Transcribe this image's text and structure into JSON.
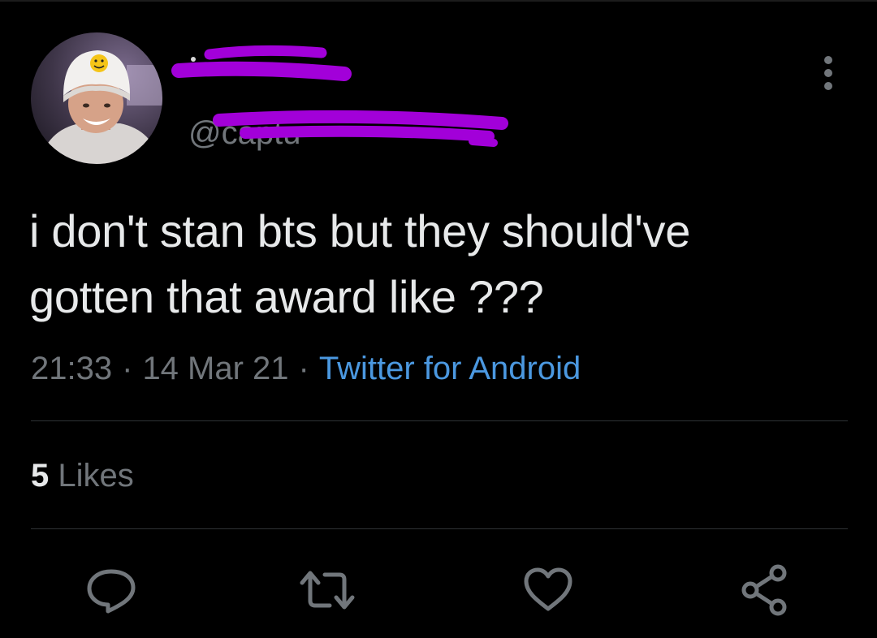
{
  "tweet": {
    "handle": "@captu",
    "text_lines": [
      "i don't stan bts but they should've",
      "gotten that award like ???"
    ],
    "time": "21:33",
    "separator": "·",
    "date": "14 Mar 21",
    "source": "Twitter for Android",
    "likes_count": "5",
    "likes_label": "Likes"
  },
  "colors": {
    "background": "#000000",
    "text": "#e7e9ea",
    "muted": "#71767b",
    "link": "#4b98e0",
    "redaction": "#a200d9"
  },
  "icons": {
    "more": "more-vertical-icon",
    "reply": "reply-icon",
    "retweet": "retweet-icon",
    "like": "heart-icon",
    "share": "share-icon"
  }
}
